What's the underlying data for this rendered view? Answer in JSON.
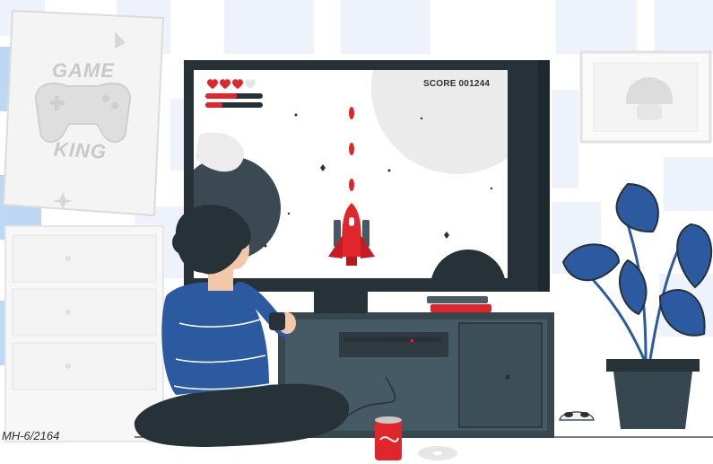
{
  "game": {
    "score_text": "SCORE 001244",
    "hearts_full": 3,
    "hearts_total": 4,
    "health_bar_fraction": 0.55,
    "energy_bar_fraction": 0.3
  },
  "poster": {
    "top_text": "GAME",
    "bottom_text": "KING"
  },
  "watermark": "MH-6/2164",
  "colors": {
    "accent_red": "#e0262b",
    "tv_dark": "#263238",
    "blue": "#2c5aa0",
    "wall_grid": "#eef3fb",
    "tab_blue": "#bcd8f2"
  }
}
